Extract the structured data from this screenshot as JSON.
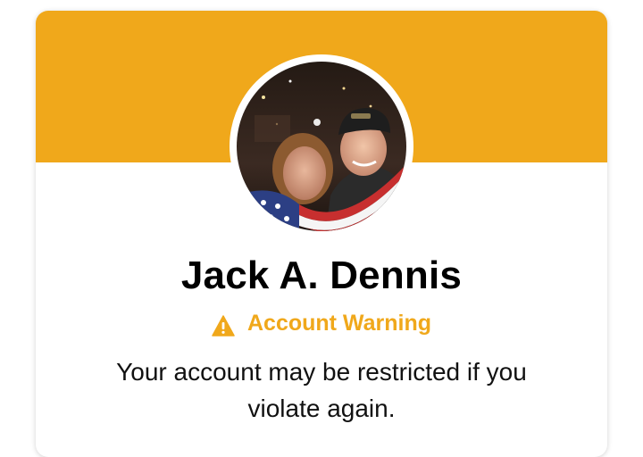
{
  "colors": {
    "banner": "#F0A81B",
    "warning": "#F0A81B",
    "text": "#000000"
  },
  "profile": {
    "name": "Jack A. Dennis",
    "avatar": "profile-photo"
  },
  "warning": {
    "icon": "warning-triangle-icon",
    "label": "Account Warning"
  },
  "message": {
    "text": "Your account may be restricted if you violate again."
  }
}
